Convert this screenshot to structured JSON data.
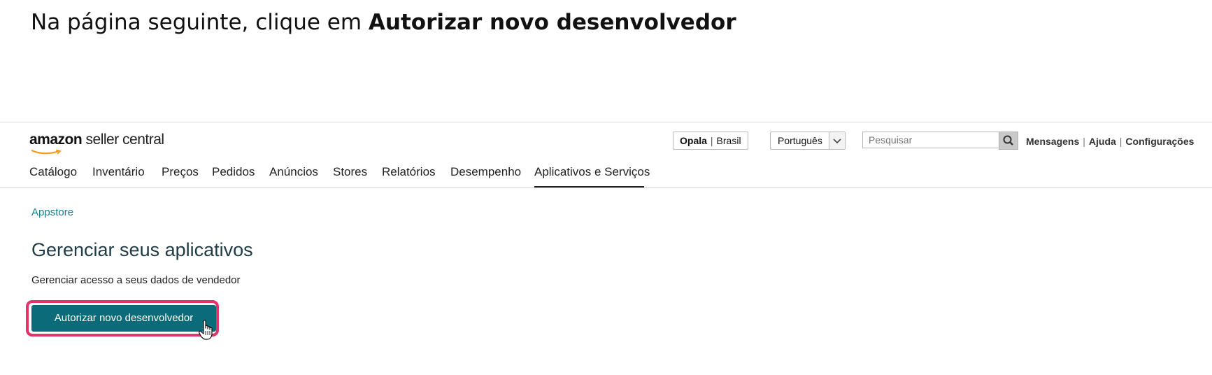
{
  "instruction": {
    "prefix": "Na página seguinte, clique em ",
    "bold": "Autorizar novo desenvolvedor"
  },
  "header": {
    "logo_brand": "amazon",
    "logo_product": " seller central",
    "store": {
      "name": "Opala",
      "separator": "|",
      "region": "Brasil"
    },
    "language": {
      "selected": "Português"
    },
    "search": {
      "placeholder": "Pesquisar"
    },
    "links": [
      {
        "label": "Mensagens"
      },
      {
        "label": "Ajuda"
      },
      {
        "label": "Configurações"
      }
    ],
    "link_separator": "|"
  },
  "nav": {
    "items": [
      {
        "label": "Catálogo"
      },
      {
        "label": "Inventário"
      },
      {
        "label": "Preços"
      },
      {
        "label": "Pedidos"
      },
      {
        "label": "Anúncios"
      },
      {
        "label": "Stores"
      },
      {
        "label": "Relatórios"
      },
      {
        "label": "Desempenho"
      },
      {
        "label": "Aplicativos e Serviços",
        "active": true
      }
    ]
  },
  "main": {
    "breadcrumb": "Appstore",
    "title": "Gerenciar seus aplicativos",
    "subtitle": "Gerenciar acesso a seus dados de vendedor",
    "primary_button": "Autorizar novo desenvolvedor"
  },
  "colors": {
    "accent_button": "#0b6b78",
    "highlight_border": "#e0356a",
    "breadcrumb_link": "#1a7f8f",
    "logo_smile": "#f29a1f"
  },
  "icons": {
    "search": "search-icon",
    "dropdown": "chevron-down-icon",
    "cursor": "hand-pointer-icon"
  }
}
